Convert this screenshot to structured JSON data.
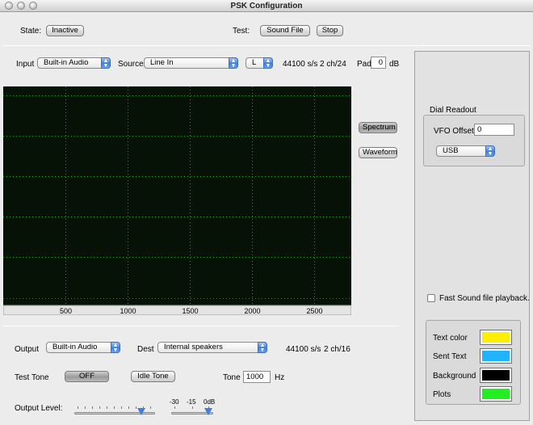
{
  "window": {
    "title": "PSK Configuration"
  },
  "state": {
    "label": "State:",
    "button": "Inactive"
  },
  "test": {
    "label": "Test:",
    "sound_file": "Sound File",
    "stop": "Stop"
  },
  "input": {
    "label": "Input",
    "device": "Built-in Audio",
    "source_label": "Source",
    "source": "Line In",
    "channel": "L",
    "rate": "44100 s/s",
    "format": "2 ch/24",
    "pad_label": "Pad",
    "pad_value": "0",
    "pad_unit": "dB"
  },
  "display": {
    "spectrum_button": "Spectrum",
    "waveform_button": "Waveform"
  },
  "chart_data": {
    "type": "line",
    "x_ticks": [
      500,
      1000,
      1500,
      2000,
      2500
    ],
    "xlim": [
      0,
      2800
    ],
    "grid": true,
    "background_color": "#051205",
    "grid_color": "#1f9a1f",
    "series": []
  },
  "output": {
    "label": "Output",
    "device": "Built-in Audio",
    "dest_label": "Dest",
    "dest": "Internal speakers",
    "rate": "44100 s/s",
    "format": "2 ch/16"
  },
  "test_tone": {
    "label": "Test Tone",
    "toggle": "OFF",
    "idle_tone": "Idle Tone",
    "tone_label": "Tone",
    "tone_value": "1000",
    "tone_unit": "Hz"
  },
  "output_level": {
    "label": "Output Level:",
    "scale": [
      "-30",
      "-15",
      "0dB"
    ]
  },
  "dial_readout": {
    "title": "Dial Readout",
    "vfo_label": "VFO Offset",
    "vfo_value": "0",
    "mode": "USB"
  },
  "fast_playback": {
    "label": "Fast Sound file playback.",
    "checked": false
  },
  "colors": [
    {
      "label": "Text color",
      "value": "#ffee00"
    },
    {
      "label": "Sent Text",
      "value": "#22b3ff"
    },
    {
      "label": "Background",
      "value": "#000000"
    },
    {
      "label": "Plots",
      "value": "#22ee22"
    }
  ]
}
